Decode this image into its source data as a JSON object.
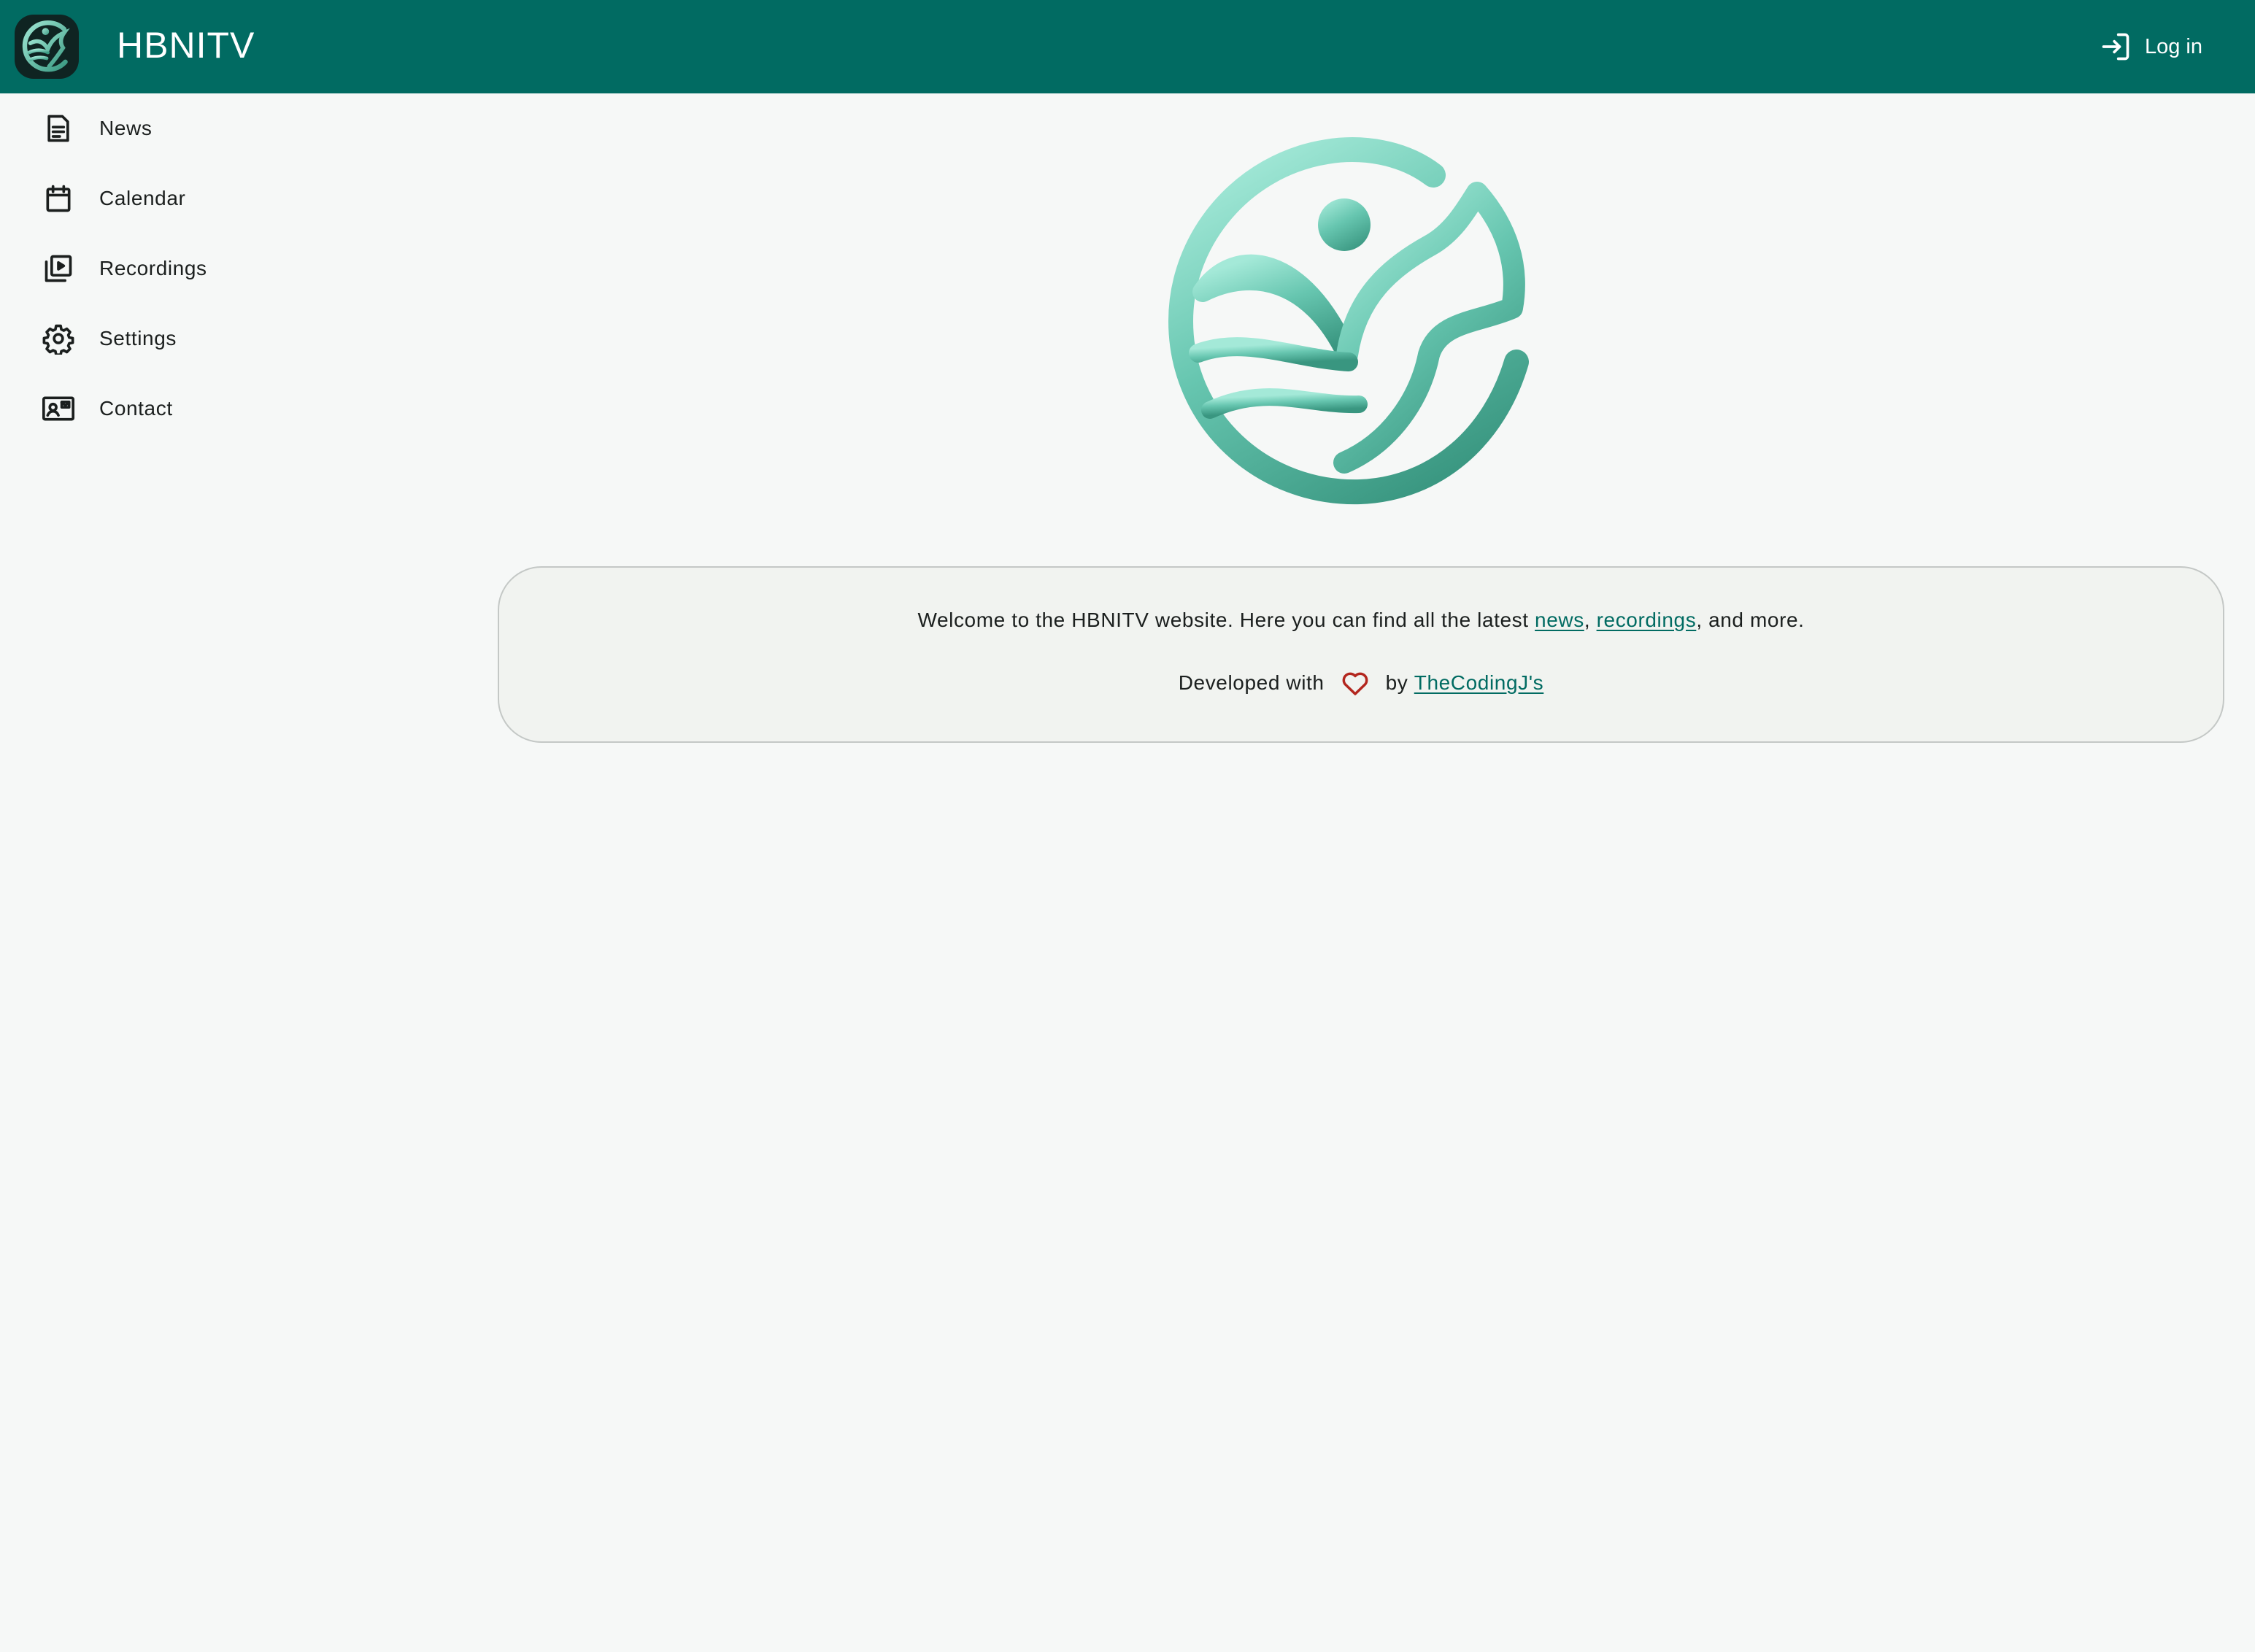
{
  "app": {
    "title": "HBNITV",
    "brand_color": "#016b62",
    "logo_icon": "hbnitv-logo-icon"
  },
  "header": {
    "login_label": "Log in",
    "login_icon": "login-icon"
  },
  "sidebar": {
    "items": [
      {
        "label": "News",
        "icon": "article-icon"
      },
      {
        "label": "Calendar",
        "icon": "calendar-icon"
      },
      {
        "label": "Recordings",
        "icon": "video-library-icon"
      },
      {
        "label": "Settings",
        "icon": "gear-icon"
      },
      {
        "label": "Contact",
        "icon": "contact-card-icon"
      }
    ]
  },
  "main": {
    "welcome": {
      "prefix": "Welcome to the HBNITV website. Here you can find all the latest",
      "news_link": "news",
      "separator": ",",
      "recordings_link": "recordings",
      "suffix": ", and more."
    },
    "credits": {
      "prefix": "Developed with",
      "heart_icon": "heart-icon",
      "by": "by",
      "author_link": "TheCodingJ's",
      "heart_color": "#b3261e"
    }
  }
}
